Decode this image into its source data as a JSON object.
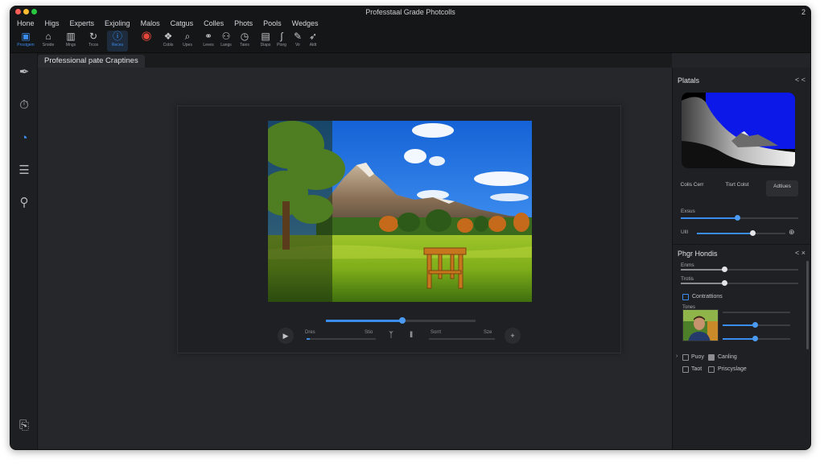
{
  "window": {
    "title": "Professtaal Grade Photcolls",
    "corner_number": "2"
  },
  "menu": [
    "Hone",
    "Higs",
    "Experts",
    "Exjoling",
    "Malos",
    "Catgus",
    "Colles",
    "Phots",
    "Pools",
    "Wedges"
  ],
  "toolbar": [
    {
      "label": "Prostgem",
      "icon": "frame-icon",
      "glyph": "▣",
      "active": true
    },
    {
      "label": "Sroide",
      "icon": "home-icon",
      "glyph": "⌂",
      "active": false
    },
    {
      "label": "Mngs",
      "icon": "layers-icon",
      "glyph": "▥",
      "active": false
    },
    {
      "label": "Trcos",
      "icon": "rotate-icon",
      "glyph": "↻",
      "active": false
    },
    {
      "label": "Reces",
      "icon": "info-icon",
      "glyph": "ⓘ",
      "active": true
    },
    {
      "label": "",
      "icon": "color-wheel-icon",
      "glyph": "◉",
      "active": false
    },
    {
      "label": "Cobls",
      "icon": "shapes-icon",
      "glyph": "❖",
      "active": false
    },
    {
      "label": "Upes",
      "icon": "search-icon",
      "glyph": "⌕",
      "active": false
    },
    {
      "label": "Leves",
      "icon": "link-icon",
      "glyph": "⚭",
      "active": false
    },
    {
      "label": "Langs",
      "icon": "users-icon",
      "glyph": "⚇",
      "active": false
    },
    {
      "label": "Taies",
      "icon": "clock-icon",
      "glyph": "◷",
      "active": false
    },
    {
      "label": "Diaps",
      "icon": "clipboard-icon",
      "glyph": "▤",
      "active": false
    },
    {
      "label": "Ptorg",
      "icon": "curve-icon",
      "glyph": "∫",
      "active": false
    },
    {
      "label": "Vir",
      "icon": "brush-icon",
      "glyph": "✎",
      "active": false
    },
    {
      "label": "Aldt",
      "icon": "pointer-icon",
      "glyph": "➶",
      "active": false
    }
  ],
  "document_tab": "Professional pate Craptines",
  "left_tools": [
    {
      "icon": "pen-icon",
      "glyph": "✒",
      "active": false
    },
    {
      "icon": "timer-icon",
      "glyph": "⏱",
      "active": false
    },
    {
      "icon": "lens-icon",
      "glyph": "◔",
      "active": true
    },
    {
      "icon": "stack-icon",
      "glyph": "☰",
      "active": false
    },
    {
      "icon": "share-icon",
      "glyph": "⚲",
      "active": false
    },
    {
      "icon": "export-icon",
      "glyph": "⎘",
      "active": false
    }
  ],
  "playback": {
    "timeline_progress": 0.51,
    "left_button": "▶",
    "right_button": "+",
    "label_a": "Dres",
    "label_b": "Stio",
    "label_c": "Sorrt",
    "label_d": "Sze",
    "mid_icon_a": "ᛉ",
    "mid_icon_b": "‖"
  },
  "right_panel": {
    "header_top": "Platals",
    "chevrons": "< <",
    "segments": {
      "a": "Colis Cerr",
      "b": "Tisrt Colst",
      "c": "Adtiues"
    },
    "slider_1": {
      "label": "Exsus",
      "value": 0.48
    },
    "slider_2": {
      "label": "Ulll",
      "value": 0.63
    },
    "section2_title": "Phgr Hondis",
    "section2_chev": "< ×",
    "slider_3": {
      "label": "Enms",
      "value": 0.37
    },
    "slider_4": {
      "label": "Trotis",
      "value": 0.37
    },
    "checkbox_contrast": "Contrattions",
    "portrait_label": "Tones",
    "portrait_sliders": [
      0.0,
      0.48,
      0.48
    ],
    "opt_1": "Puoy",
    "opt_2": "Canling",
    "opt_3": "Taot",
    "opt_4": "Priscyslage"
  }
}
